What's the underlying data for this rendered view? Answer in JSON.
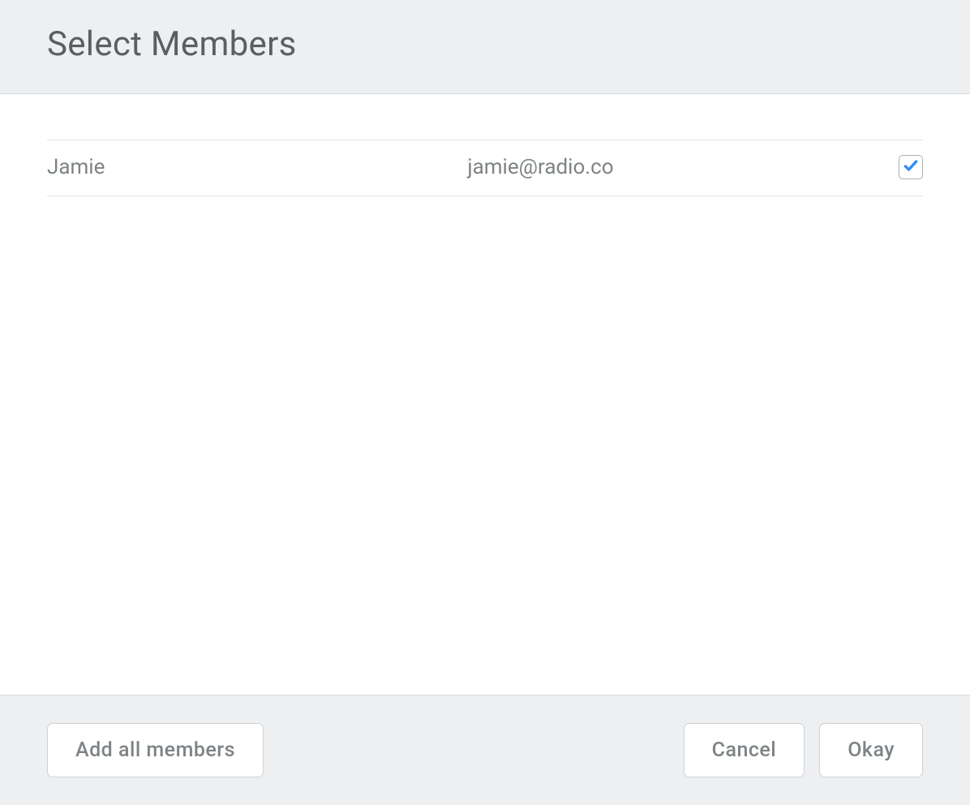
{
  "header": {
    "title": "Select Members"
  },
  "members": [
    {
      "name": "Jamie",
      "email": "jamie@radio.co",
      "checked": true
    }
  ],
  "footer": {
    "add_all_label": "Add all members",
    "cancel_label": "Cancel",
    "okay_label": "Okay"
  }
}
